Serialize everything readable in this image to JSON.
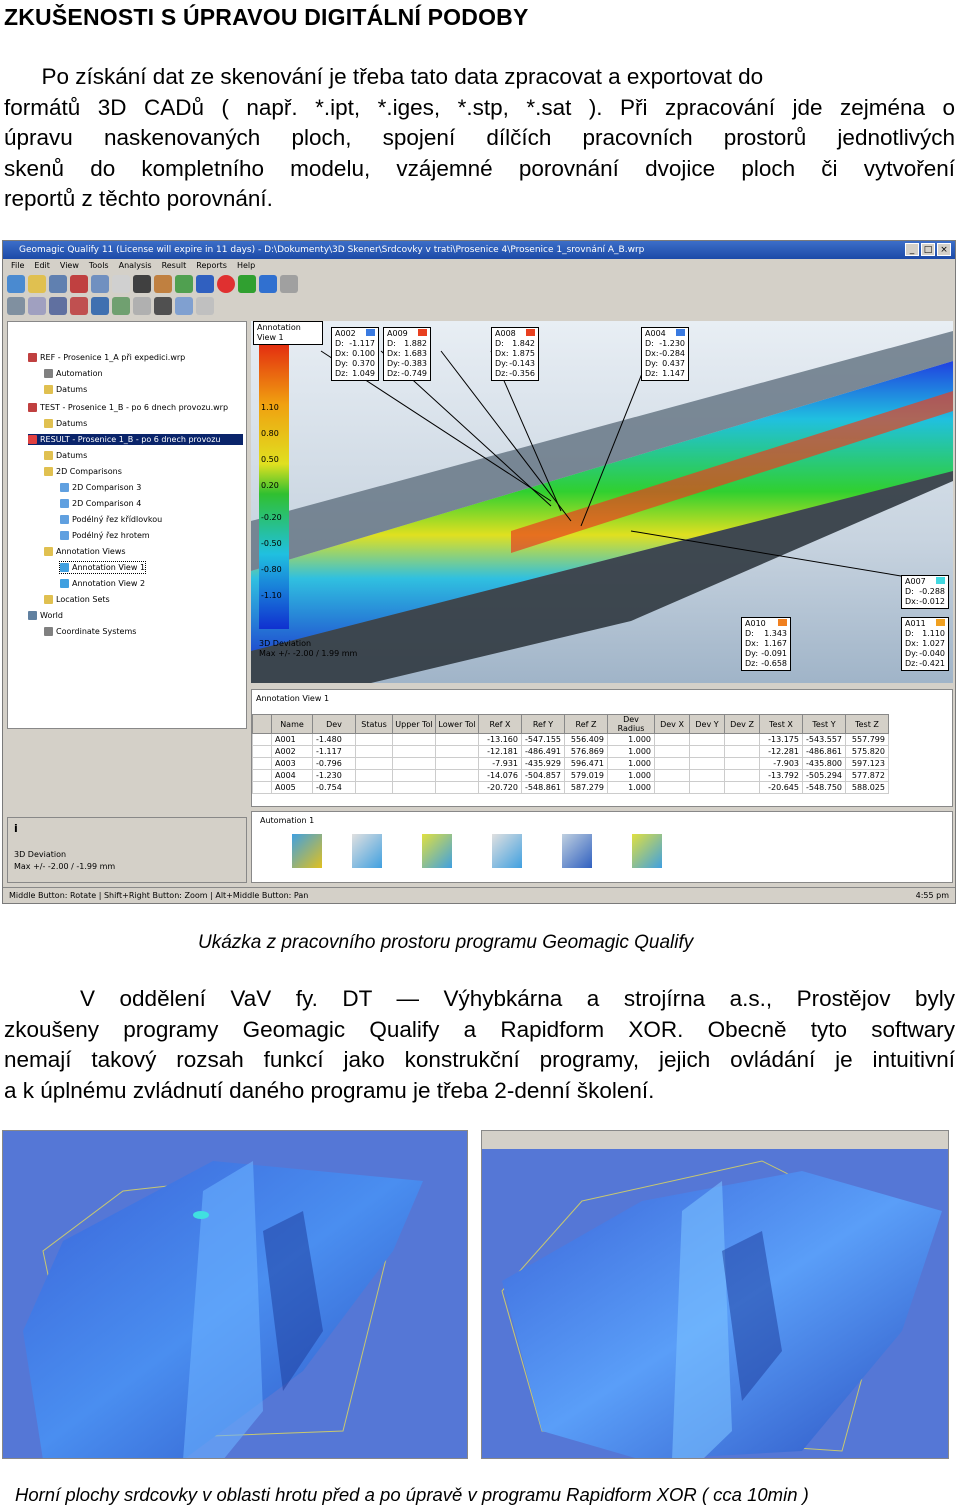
{
  "heading": "ZKUŠENOSTI S ÚPRAVOU DIGITÁLNÍ PODOBY",
  "para1_lines": [
    "      Po získání dat ze skenování je třeba tato data zpracovat a exportovat do",
    "formátů 3D CADů ( např. *.ipt, *.iges, *.stp, *.sat ). Při zpracování jde zejména o",
    "úpravu naskenovaných ploch, spojení dílčích pracovních prostorů jednotlivých",
    "skenů do kompletního modelu, vzájemné porovnání dvojice ploch či vytvoření",
    "reportů z těchto porovnání."
  ],
  "screenshot": {
    "title": "Geomagic Qualify 11 (License will expire in 11 days) - D:\\Dokumenty\\3D Skener\\Srdcovky v trati\\Prosenice 4\\Prosenice 1_srovnání A_B.wrp",
    "menu": [
      "File",
      "Edit",
      "View",
      "Tools",
      "Analysis",
      "Result",
      "Reports",
      "Help"
    ],
    "tree": [
      "REF - Prosenice 1_A při expedici.wrp",
      "Automation",
      "Datums",
      "TEST - Prosenice 1_B - po 6 dnech provozu.wrp",
      "Datums",
      "RESULT - Prosenice 1_B - po 6 dnech provozu",
      "Datums",
      "2D Comparisons",
      "2D Comparison 3",
      "2D Comparison 4",
      "Podélný řez křídlovkou",
      "Podélný řez hrotem",
      "Annotation Views",
      "Annotation View 1",
      "Annotation View 2",
      "Location Sets",
      "World",
      "Coordinate Systems"
    ],
    "viewport_tab": "Annotation View 1",
    "legend_labels": [
      "1.10",
      "0.80",
      "0.50",
      "0.20",
      "-0.20",
      "-0.50",
      "-0.80",
      "-1.10"
    ],
    "annotations": [
      {
        "id": "A002",
        "rows": [
          [
            "D:",
            "-1.117"
          ],
          [
            "Dx:",
            "0.100"
          ],
          [
            "Dy:",
            "0.370"
          ],
          [
            "Dz:",
            "1.049"
          ]
        ],
        "color": "#3a7ae0"
      },
      {
        "id": "A009",
        "rows": [
          [
            "D:",
            "1.882"
          ],
          [
            "Dx:",
            "1.683"
          ],
          [
            "Dy:",
            "-0.383"
          ],
          [
            "Dz:",
            "-0.749"
          ]
        ],
        "color": "#e84020"
      },
      {
        "id": "A008",
        "rows": [
          [
            "D:",
            "1.842"
          ],
          [
            "Dx:",
            "1.875"
          ],
          [
            "Dy:",
            "-0.143"
          ],
          [
            "Dz:",
            "-0.356"
          ]
        ],
        "color": "#e84020"
      },
      {
        "id": "A004",
        "rows": [
          [
            "D:",
            "-1.230"
          ],
          [
            "Dx:",
            "-0.284"
          ],
          [
            "Dy:",
            "0.437"
          ],
          [
            "Dz:",
            "1.147"
          ]
        ],
        "color": "#3a7ae0"
      },
      {
        "id": "A007",
        "rows": [
          [
            "D:",
            "-0.288"
          ],
          [
            "Dx:",
            "-0.012"
          ]
        ],
        "color": "#40d8e0"
      },
      {
        "id": "A010",
        "rows": [
          [
            "D:",
            "1.343"
          ],
          [
            "Dx:",
            "1.167"
          ],
          [
            "Dy:",
            "-0.091"
          ],
          [
            "Dz:",
            "-0.658"
          ]
        ],
        "color": "#f08020"
      },
      {
        "id": "A011",
        "rows": [
          [
            "D:",
            "1.110"
          ],
          [
            "Dx:",
            "1.027"
          ],
          [
            "Dy:",
            "-0.040"
          ],
          [
            "Dz:",
            "-0.421"
          ]
        ],
        "color": "#f0a020"
      }
    ],
    "dev_info": [
      "3D Deviation",
      "Max +/- -2.00 / 1.99 mm",
      "Middle Button: Rotate"
    ],
    "table_title": "Annotation View 1",
    "table_headers": [
      "Name",
      "Dev",
      "Status",
      "Upper Tol",
      "Lower Tol",
      "Ref X",
      "Ref Y",
      "Ref Z",
      "Dev Radius",
      "Dev X",
      "Dev Y",
      "Dev Z",
      "Test X",
      "Test Y",
      "Test Z"
    ],
    "table_rows": [
      [
        "A001",
        "-1.480",
        "",
        "",
        "",
        "-13.160",
        "-547.155",
        "556.409",
        "1.000",
        "",
        "",
        "",
        "-13.175",
        "-543.557",
        "557.799"
      ],
      [
        "A002",
        "-1.117",
        "",
        "",
        "",
        "-12.181",
        "-486.491",
        "576.869",
        "1.000",
        "",
        "",
        "",
        "-12.281",
        "-486.861",
        "575.820"
      ],
      [
        "A003",
        "-0.796",
        "",
        "",
        "",
        "-7.931",
        "-435.929",
        "596.471",
        "1.000",
        "",
        "",
        "",
        "-7.903",
        "-435.800",
        "597.123"
      ],
      [
        "A004",
        "-1.230",
        "",
        "",
        "",
        "-14.076",
        "-504.857",
        "579.019",
        "1.000",
        "",
        "",
        "",
        "-13.792",
        "-505.294",
        "577.872"
      ],
      [
        "A005",
        "-0.754",
        "",
        "",
        "",
        "-20.720",
        "-548.861",
        "587.279",
        "1.000",
        "",
        "",
        "",
        "-20.645",
        "-548.750",
        "588.025"
      ]
    ],
    "automation_title": "Automation 1",
    "info_label": "3D Deviation",
    "info_value": "Max +/- -2.00 / -1.99 mm",
    "status_text": "Middle Button: Rotate | Shift+Right Button: Zoom | Alt+Middle Button: Pan",
    "status_time": "4:55 pm"
  },
  "caption1": "Ukázka z pracovního prostoru programu Geomagic Qualify",
  "para2_lines": [
    "V oddělení VaV fy. DT — Výhybkárna a strojírna a.s., Prostějov byly",
    "zkoušeny programy Geomagic Qualify a Rapidform XOR. Obecně tyto softwary",
    "nemají takový rozsah funkcí jako konstrukční programy, jejich ovládání je intuitivní",
    "a k úplnému zvládnutí daného programu je třeba 2-denní školení."
  ],
  "caption2": "Horní plochy srdcovky v oblasti hrotu před a po úpravě v programu Rapidform XOR ( cca 10min )"
}
